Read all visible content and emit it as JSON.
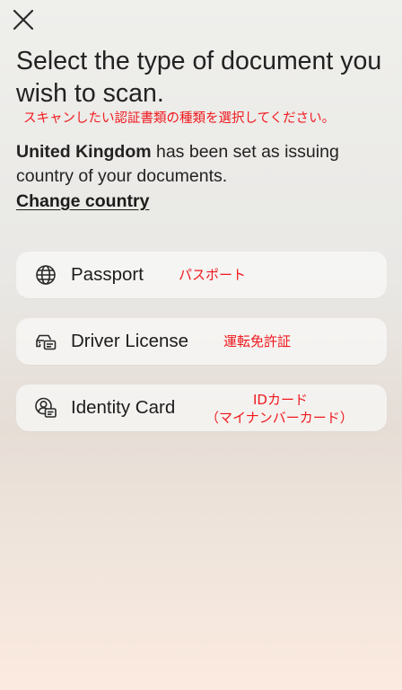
{
  "header": {
    "close_icon": "close-icon"
  },
  "title": "Select the type of document you wish to scan.",
  "annotations": {
    "title_ja": "スキャンしたい認証書類の種類を選択してください。",
    "passport_ja": "パスポート",
    "driver_license_ja": "運転免許証",
    "identity_card_ja_line1": "IDカード",
    "identity_card_ja_line2": "（マイナンバーカード）"
  },
  "issuing_info": {
    "country": "United Kingdom",
    "text": " has been set as issuing country of your documents."
  },
  "change_country_label": "Change country",
  "document_options": [
    {
      "label": "Passport",
      "icon": "globe-icon"
    },
    {
      "label": "Driver License",
      "icon": "car-id-icon"
    },
    {
      "label": "Identity Card",
      "icon": "person-id-icon"
    }
  ],
  "colors": {
    "annotation": "#f0191e",
    "text": "#1c1c1c"
  }
}
